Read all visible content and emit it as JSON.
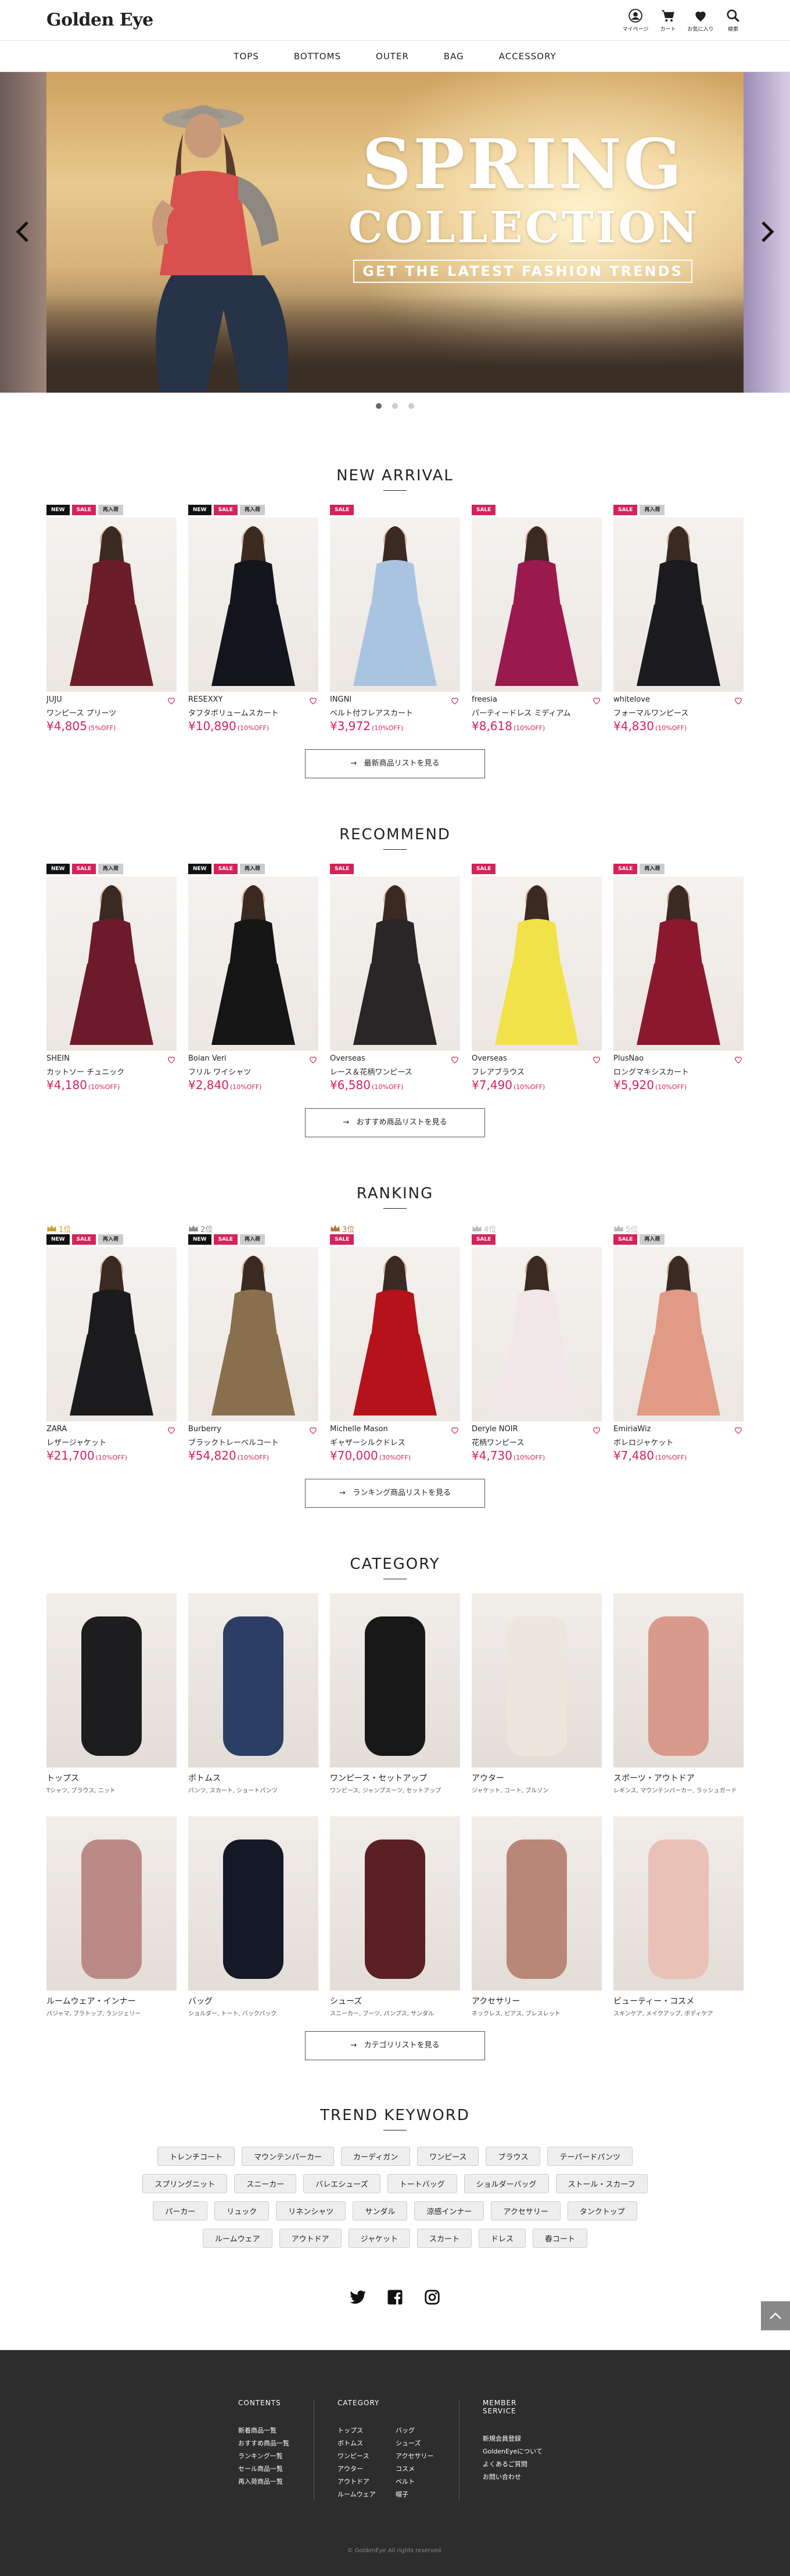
{
  "header": {
    "logo": "Golden Eye",
    "icons": [
      {
        "name": "user-icon",
        "label": "マイページ"
      },
      {
        "name": "cart-icon",
        "label": "カート"
      },
      {
        "name": "heart-icon",
        "label": "お気に入り"
      },
      {
        "name": "search-icon",
        "label": "検索"
      }
    ]
  },
  "nav": [
    "TOPS",
    "BOTTOMS",
    "OUTER",
    "BAG",
    "ACCESSORY"
  ],
  "hero": {
    "title1": "SPRING",
    "title2": "COLLECTION",
    "tagline": "GET THE LATEST FASHION TRENDS",
    "slides": 3,
    "active": 0
  },
  "badge_labels": {
    "new": "NEW",
    "sale": "SALE",
    "re": "再入荷"
  },
  "new_arrival": {
    "title": "NEW ARRIVAL",
    "more": "最新商品リストを見る",
    "items": [
      {
        "brand": "JUJU",
        "name": "ワンピース プリーツ",
        "price": "¥4,805",
        "off": "(5%OFF)",
        "badges": [
          "new",
          "sale",
          "re"
        ],
        "color": "#6b1d2a"
      },
      {
        "brand": "RESEXXY",
        "name": "タフタボリュームスカート",
        "price": "¥10,890",
        "off": "(10%OFF)",
        "badges": [
          "new",
          "sale",
          "re"
        ],
        "color": "#14151c"
      },
      {
        "brand": "INGNI",
        "name": "ベルト付フレアスカート",
        "price": "¥3,972",
        "off": "(10%OFF)",
        "badges": [
          "sale"
        ],
        "color": "#a9c4e0"
      },
      {
        "brand": "freesia",
        "name": "パーティードレス ミディアム",
        "price": "¥8,618",
        "off": "(10%OFF)",
        "badges": [
          "sale"
        ],
        "color": "#9b1a4e"
      },
      {
        "brand": "whitelove",
        "name": "フォーマルワンピース",
        "price": "¥4,830",
        "off": "(10%OFF)",
        "badges": [
          "sale",
          "re"
        ],
        "color": "#1a1a1f"
      }
    ]
  },
  "recommend": {
    "title": "RECOMMEND",
    "more": "おすすめ商品リストを見る",
    "items": [
      {
        "brand": "SHEIN",
        "name": "カットソー チュニック",
        "price": "¥4,180",
        "off": "(10%OFF)",
        "badges": [
          "new",
          "sale",
          "re"
        ],
        "color": "#6d1a2a"
      },
      {
        "brand": "Boian Veri",
        "name": "フリル ワイシャツ",
        "price": "¥2,840",
        "off": "(10%OFF)",
        "badges": [
          "new",
          "sale",
          "re"
        ],
        "color": "#151515"
      },
      {
        "brand": "Overseas",
        "name": "レース＆花柄ワンピース",
        "price": "¥6,580",
        "off": "(10%OFF)",
        "badges": [
          "sale"
        ],
        "color": "#2a2526"
      },
      {
        "brand": "Overseas",
        "name": "フレアブラウス",
        "price": "¥7,490",
        "off": "(10%OFF)",
        "badges": [
          "sale"
        ],
        "color": "#f2e24a"
      },
      {
        "brand": "PlusNao",
        "name": "ロングマキシスカート",
        "price": "¥5,920",
        "off": "(10%OFF)",
        "badges": [
          "sale",
          "re"
        ],
        "color": "#8c1830"
      }
    ]
  },
  "ranking": {
    "title": "RANKING",
    "more": "ランキング商品リストを見る",
    "items": [
      {
        "rank": "1位",
        "rank_color": "#c9a227",
        "brand": "ZARA",
        "name": "レザージャケット",
        "price": "¥21,700",
        "off": "(10%OFF)",
        "badges": [
          "new",
          "sale",
          "re"
        ],
        "color": "#1b1b1d"
      },
      {
        "rank": "2位",
        "rank_color": "#8a8a8a",
        "brand": "Burberry",
        "name": "ブラックトレーベルコート",
        "price": "¥54,820",
        "off": "(10%OFF)",
        "badges": [
          "new",
          "sale",
          "re"
        ],
        "color": "#8a6f4e"
      },
      {
        "rank": "3位",
        "rank_color": "#b5773b",
        "brand": "Michelle Mason",
        "name": "ギャザーシルクドレス",
        "price": "¥70,000",
        "off": "(30%OFF)",
        "badges": [
          "sale"
        ],
        "color": "#b5121b"
      },
      {
        "rank": "4位",
        "rank_color": "#bbbbbb",
        "brand": "Deryle NOIR",
        "name": "花柄ワンピース",
        "price": "¥4,730",
        "off": "(10%OFF)",
        "badges": [
          "sale"
        ],
        "color": "#f3e6e8"
      },
      {
        "rank": "5位",
        "rank_color": "#bbbbbb",
        "brand": "EmiriaWiz",
        "name": "ボレロジャケット",
        "price": "¥7,480",
        "off": "(10%OFF)",
        "badges": [
          "sale",
          "re"
        ],
        "color": "#e09a85"
      }
    ]
  },
  "category": {
    "title": "CATEGORY",
    "more": "カテゴリリストを見る",
    "items": [
      {
        "name": "トップス",
        "sub": "Tシャツ, ブラウス, ニット",
        "color": "#1d1d1f"
      },
      {
        "name": "ボトムス",
        "sub": "パンツ, スカート, ショートパンツ",
        "color": "#2d3e64"
      },
      {
        "name": "ワンピース・セットアップ",
        "sub": "ワンピース, ジャンプスーツ, セットアップ",
        "color": "#181818"
      },
      {
        "name": "アウター",
        "sub": "ジャケット, コート, ブルゾン",
        "color": "#ece7dc"
      },
      {
        "name": "スポーツ・アウトドア",
        "sub": "レギンス, マウンテンパーカー, ラッシュガード",
        "color": "#d89a8c"
      },
      {
        "name": "ルームウェア・インナー",
        "sub": "パジャマ, ブラトップ, ランジェリー",
        "color": "#bc8a86"
      },
      {
        "name": "バッグ",
        "sub": "ショルダー, トート, バックパック",
        "color": "#151826"
      },
      {
        "name": "シューズ",
        "sub": "スニーカー, ブーツ, パンプス, サンダル",
        "color": "#5a2026"
      },
      {
        "name": "アクセサリー",
        "sub": "ネックレス, ピアス, ブレスレット",
        "color": "#b98777"
      },
      {
        "name": "ビューティー・コスメ",
        "sub": "スキンケア, メイクアップ, ボディケア",
        "color": "#e9c1b7"
      }
    ]
  },
  "trend": {
    "title": "TREND KEYWORD",
    "keywords": [
      "トレンチコート",
      "マウンテンパーカー",
      "カーディガン",
      "ワンピース",
      "ブラウス",
      "テーパードパンツ",
      "スプリングニット",
      "スニーカー",
      "バレエシューズ",
      "トートバッグ",
      "ショルダーバッグ",
      "ストール・スカーフ",
      "パーカー",
      "リュック",
      "リネンシャツ",
      "サンダル",
      "涼感インナー",
      "アクセサリー",
      "タンクトップ",
      "ルームウェア",
      "アウトドア",
      "ジャケット",
      "スカート",
      "ドレス",
      "春コート"
    ]
  },
  "social": [
    "twitter-icon",
    "facebook-icon",
    "instagram-icon"
  ],
  "footer": {
    "col1": {
      "title": "CONTENTS",
      "links": [
        "新着商品一覧",
        "おすすめ商品一覧",
        "ランキング一覧",
        "セール商品一覧",
        "再入荷商品一覧"
      ]
    },
    "col2": {
      "title": "CATEGORY",
      "links": [
        "トップス",
        "バッグ",
        "ボトムス",
        "シューズ",
        "ワンピース",
        "アクセサリー",
        "アウター",
        "コスメ",
        "アウトドア",
        "ベルト",
        "ルームウェア",
        "帽子"
      ]
    },
    "col3": {
      "title": "MEMBER SERVICE",
      "links": [
        "新規会員登録",
        "GoldenEyeについて",
        "よくあるご質問",
        "お問い合わせ"
      ]
    },
    "copyright": "©  GoldenEye All rights reserved."
  }
}
